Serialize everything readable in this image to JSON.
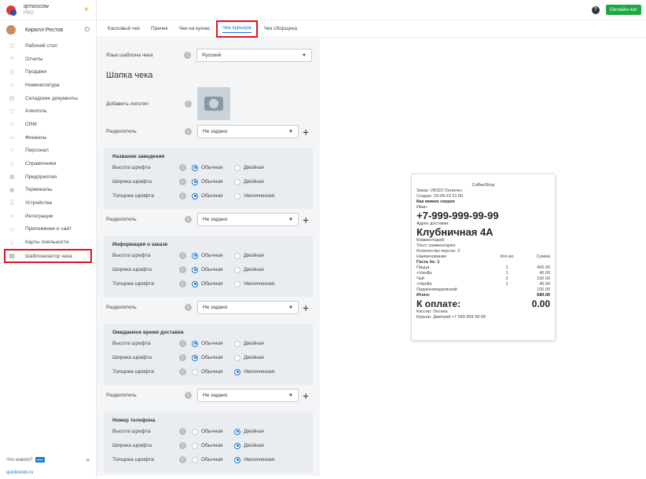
{
  "sidebar": {
    "org_name": "qrmoscow",
    "org_plan": "PRO",
    "user_name": "Кирилл Рестов",
    "items": [
      {
        "label": "Рабочий стол",
        "icon": "dashboard-icon"
      },
      {
        "label": "Отчеты",
        "icon": "chart-icon"
      },
      {
        "label": "Продажи",
        "icon": "cart-icon"
      },
      {
        "label": "Номенклатура",
        "icon": "tag-icon"
      },
      {
        "label": "Складские документы",
        "icon": "doc-icon"
      },
      {
        "label": "Алкоголь",
        "icon": "glass-icon"
      },
      {
        "label": "CRM",
        "icon": "crm-icon"
      },
      {
        "label": "Финансы",
        "icon": "wallet-icon"
      },
      {
        "label": "Персонал",
        "icon": "people-icon"
      },
      {
        "label": "Справочники",
        "icon": "book-icon"
      },
      {
        "label": "Предприятия",
        "icon": "building-icon"
      },
      {
        "label": "Терминалы",
        "icon": "terminal-icon"
      },
      {
        "label": "Устройства",
        "icon": "printer-icon"
      },
      {
        "label": "Интеграции",
        "icon": "link-icon"
      },
      {
        "label": "Приложение и сайт",
        "icon": "app-icon"
      },
      {
        "label": "Карты лояльности",
        "icon": "card-icon"
      },
      {
        "label": "Шаблонизатор чека",
        "icon": "receipt-icon"
      }
    ],
    "whats_new": "Что нового?",
    "new_badge": "new",
    "link": "quickresto.ru"
  },
  "topbar": {
    "help": "?",
    "chat_button": "Онлайн-чат"
  },
  "tabs": [
    "Кассовый чек",
    "Пречек",
    "Чек на кухню",
    "Чек курьера",
    "Чек сборщика"
  ],
  "form": {
    "lang_label": "Язык шаблона чека",
    "lang_value": "Русский",
    "header_title": "Шапка чека",
    "logo_label": "Добавить логотип",
    "sep_label": "Разделитель",
    "sep_value": "Не задано",
    "sections": [
      {
        "title": "Название заведения",
        "rows": [
          {
            "label": "Высота шрифта",
            "opt1": "Обычная",
            "opt2": "Двойная",
            "sel": 1
          },
          {
            "label": "Ширина шрифта",
            "opt1": "Обычная",
            "opt2": "Двойная",
            "sel": 1
          },
          {
            "label": "Толщина шрифта",
            "opt1": "Обычная",
            "opt2": "Увеличенная",
            "sel": 1
          }
        ]
      },
      {
        "title": "Информация о заказе",
        "rows": [
          {
            "label": "Высота шрифта",
            "opt1": "Обычная",
            "opt2": "Двойная",
            "sel": 1
          },
          {
            "label": "Ширина шрифта",
            "opt1": "Обычная",
            "opt2": "Двойная",
            "sel": 1
          },
          {
            "label": "Толщина шрифта",
            "opt1": "Обычная",
            "opt2": "Увеличенная",
            "sel": 1
          }
        ]
      },
      {
        "title": "Ожидаемое время доставки",
        "rows": [
          {
            "label": "Высота шрифта",
            "opt1": "Обычная",
            "opt2": "Двойная",
            "sel": 1
          },
          {
            "label": "Ширина шрифта",
            "opt1": "Обычная",
            "opt2": "Двойная",
            "sel": 1
          },
          {
            "label": "Толщина шрифта",
            "opt1": "Обычная",
            "opt2": "Увеличенная",
            "sel": 2
          }
        ]
      },
      {
        "title": "Номер телефона",
        "rows": [
          {
            "label": "Высота шрифта",
            "opt1": "Обычная",
            "opt2": "Двойная",
            "sel": 2
          },
          {
            "label": "Ширина шрифта",
            "opt1": "Обычная",
            "opt2": "Двойная",
            "sel": 2
          },
          {
            "label": "Толщина шрифта",
            "opt1": "Обычная",
            "opt2": "Увеличенная",
            "sel": 2
          }
        ]
      }
    ]
  },
  "receipt": {
    "shop": "CoffeeShop",
    "order": "Заказ: VB322 Оплачен",
    "created": "Создан: 23-04-23 21:00",
    "asap": "Как можно скорее",
    "client": "Иван",
    "phone": "+7-999-999-99-99",
    "addr_label": "Адрес доставки:",
    "address": "Клубничная 4А",
    "comment_label": "Комментарий:",
    "comment": "Текст комментария",
    "persons": "Количество персон: 2",
    "col_name": "Наименование",
    "col_qty": "Кол-во",
    "col_sum": "Сумма",
    "guest": "Гость №: 1",
    "lines": [
      [
        "Пицца",
        "1",
        "400.00"
      ],
      [
        "+Vanilla",
        "1",
        "40.00"
      ],
      [
        "Чай",
        "2",
        "100.00"
      ],
      [
        "+Vanilla",
        "1",
        "40.00"
      ],
      [
        "Орджоникидзевский",
        "",
        "100.00"
      ]
    ],
    "total_label": "Итого:",
    "total": "680.00",
    "pay_label": "К оплате:",
    "pay": "0.00",
    "cashier": "Кассир: Оксана",
    "courier": "Курьер: Дмитрий +7 999 909 99 99"
  }
}
